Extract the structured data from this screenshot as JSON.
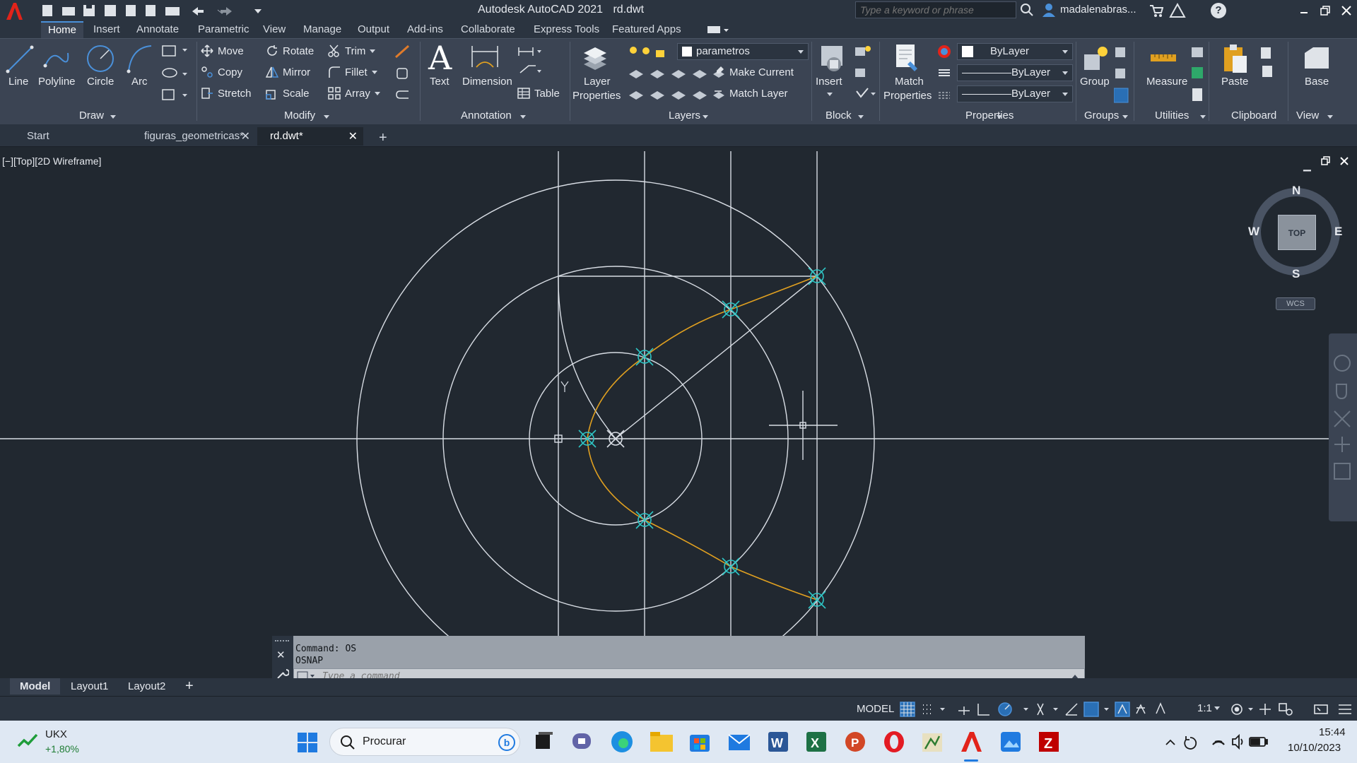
{
  "app": {
    "title": "Autodesk AutoCAD 2021",
    "file": "rd.dwt",
    "search_placeholder": "Type a keyword or phrase",
    "user": "madalenabras...",
    "help": "?"
  },
  "menu_tabs": [
    "Home",
    "Insert",
    "Annotate",
    "Parametric",
    "View",
    "Manage",
    "Output",
    "Add-ins",
    "Collaborate",
    "Express Tools",
    "Featured Apps"
  ],
  "ribbon": {
    "draw": {
      "line": "Line",
      "polyline": "Polyline",
      "circle": "Circle",
      "arc": "Arc",
      "label": "Draw"
    },
    "modify": {
      "move": "Move",
      "rotate": "Rotate",
      "trim": "Trim",
      "copy": "Copy",
      "mirror": "Mirror",
      "fillet": "Fillet",
      "stretch": "Stretch",
      "scale": "Scale",
      "array": "Array",
      "label": "Modify"
    },
    "annotation": {
      "text": "Text",
      "dimension": "Dimension",
      "table": "Table",
      "label": "Annotation"
    },
    "layers": {
      "properties_l1": "Layer",
      "properties_l2": "Properties",
      "layer_name": "parametros",
      "make_current": "Make Current",
      "match_layer": "Match Layer",
      "label": "Layers"
    },
    "block": {
      "insert": "Insert",
      "label": "Block"
    },
    "properties": {
      "match_l1": "Match",
      "match_l2": "Properties",
      "color": "ByLayer",
      "linetype": "ByLayer",
      "lineweight": "ByLayer",
      "label": "Properties"
    },
    "groups": {
      "group": "Group",
      "label": "Groups"
    },
    "utilities": {
      "measure": "Measure",
      "label": "Utilities"
    },
    "clipboard": {
      "paste": "Paste",
      "label": "Clipboard"
    },
    "view": {
      "base": "Base",
      "label": "View"
    }
  },
  "doc_tabs": [
    {
      "label": "Start"
    },
    {
      "label": "figuras_geometricas*"
    },
    {
      "label": "rd.dwt*"
    }
  ],
  "viewport": {
    "label": "[−][Top][2D Wireframe]",
    "viewcube": {
      "n": "N",
      "s": "S",
      "e": "E",
      "w": "W",
      "top": "TOP",
      "wcs": "WCS"
    }
  },
  "command": {
    "history": [
      "Command: OS",
      "OSNAP"
    ],
    "placeholder": "Type a command"
  },
  "layout_tabs": [
    "Model",
    "Layout1",
    "Layout2"
  ],
  "status": {
    "model": "MODEL",
    "scale": "1:1"
  },
  "taskbar": {
    "stock_name": "UKX",
    "stock_change": "+1,80%",
    "search": "Procurar",
    "time": "15:44",
    "date": "10/10/2023"
  },
  "colors": {
    "accent": "#4a90d9",
    "curve": "#e0a020",
    "snap": "#2ec4c4",
    "line": "#d8dde4"
  }
}
